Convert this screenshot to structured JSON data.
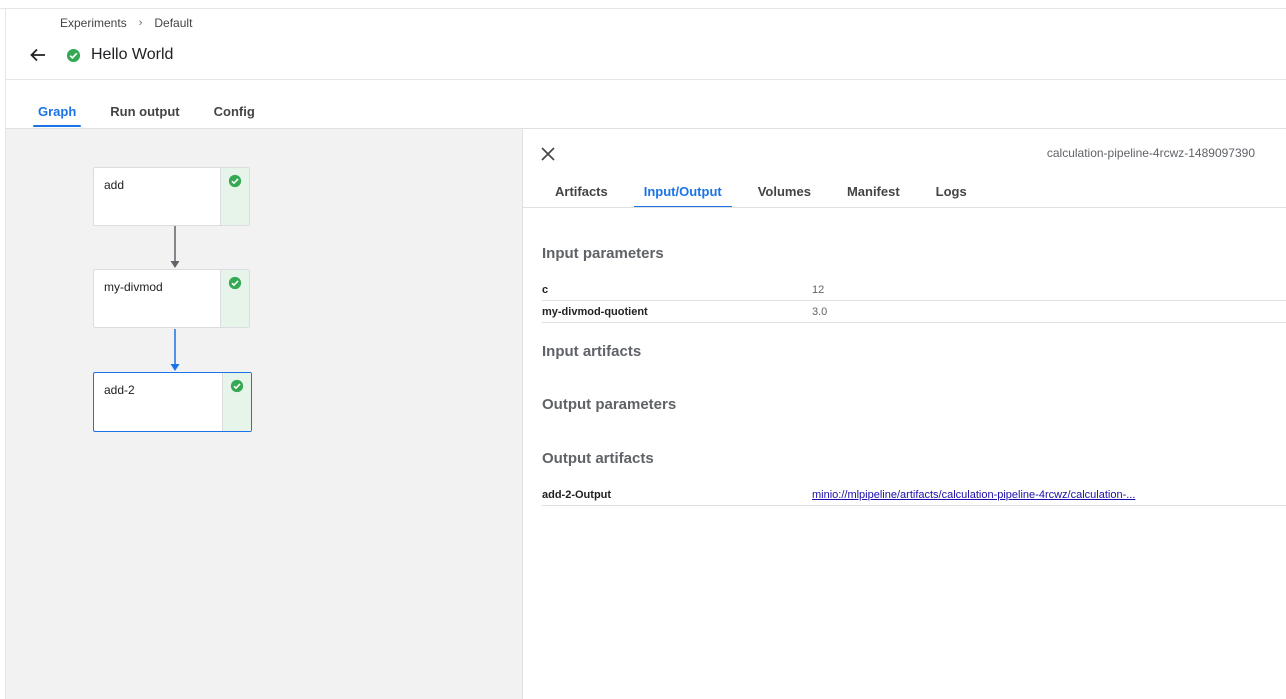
{
  "breadcrumb": {
    "items": [
      "Experiments",
      "Default"
    ],
    "separator": "›"
  },
  "header": {
    "title": "Hello World",
    "status_icon": "check-circle-icon",
    "status_color": "#34a853"
  },
  "main_tabs": [
    {
      "label": "Graph",
      "active": true
    },
    {
      "label": "Run output",
      "active": false
    },
    {
      "label": "Config",
      "active": false
    }
  ],
  "graph": {
    "nodes": [
      {
        "label": "add",
        "status": "succeeded",
        "selected": false
      },
      {
        "label": "my-divmod",
        "status": "succeeded",
        "selected": false
      },
      {
        "label": "add-2",
        "status": "succeeded",
        "selected": true
      }
    ],
    "edge_color": "#5f6368",
    "selected_edge_color": "#1a73e8"
  },
  "panel": {
    "run_id": "calculation-pipeline-4rcwz-1489097390",
    "tabs": [
      {
        "label": "Artifacts",
        "active": false
      },
      {
        "label": "Input/Output",
        "active": true
      },
      {
        "label": "Volumes",
        "active": false
      },
      {
        "label": "Manifest",
        "active": false
      },
      {
        "label": "Logs",
        "active": false
      }
    ],
    "input_parameters_title": "Input parameters",
    "input_parameters": [
      {
        "key": "c",
        "value": "12"
      },
      {
        "key": "my-divmod-quotient",
        "value": "3.0"
      }
    ],
    "input_artifacts_title": "Input artifacts",
    "output_parameters_title": "Output parameters",
    "output_artifacts_title": "Output artifacts",
    "output_artifacts": [
      {
        "key": "add-2-Output",
        "value": "minio://mlpipeline/artifacts/calculation-pipeline-4rcwz/calculation-..."
      }
    ]
  },
  "colors": {
    "accent": "#1a73e8",
    "success": "#34a853",
    "graph_bg": "#f2f2f2"
  }
}
